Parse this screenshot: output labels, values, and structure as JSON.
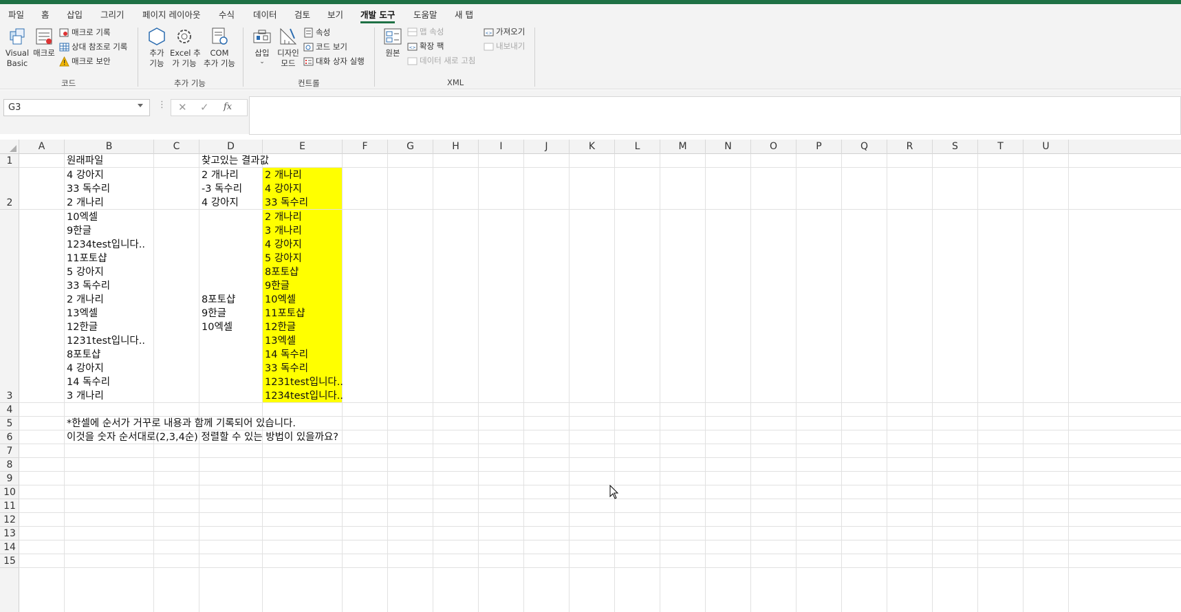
{
  "ribbon_tabs": [
    "파일",
    "홈",
    "삽입",
    "그리기",
    "페이지 레이아웃",
    "수식",
    "데이터",
    "검토",
    "보기",
    "개발 도구",
    "도움말",
    "새 탭"
  ],
  "active_tab": "개발 도구",
  "ribbon": {
    "code": {
      "label": "코드",
      "visual_basic": "Visual\nBasic",
      "macro": "매크로",
      "record_macro": "매크로 기록",
      "relative_ref": "상대 참조로 기록",
      "macro_security": "매크로 보안"
    },
    "addins": {
      "label": "추가 기능",
      "addins": "추가\n기능",
      "excel_addins": "Excel 추\n가 기능",
      "com_addins": "COM\n추가 기능"
    },
    "controls": {
      "label": "컨트롤",
      "insert": "삽입",
      "design_mode": "디자인\n모드",
      "properties": "속성",
      "view_code": "코드 보기",
      "run_dialog": "대화 상자 실행"
    },
    "xml": {
      "label": "XML",
      "source": "원본",
      "map_properties": "맵 속성",
      "expansion_packs": "확장 팩",
      "refresh_data": "데이터 새로 고침",
      "import": "가져오기",
      "export": "내보내기"
    }
  },
  "formula_bar": {
    "name_box": "G3",
    "cancel_glyph": "✕",
    "enter_glyph": "✓",
    "fx_glyph": "fx",
    "formula": ""
  },
  "columns": [
    "A",
    "B",
    "C",
    "D",
    "E",
    "F",
    "G",
    "H",
    "I",
    "J",
    "K",
    "L",
    "M",
    "N",
    "O",
    "P",
    "Q",
    "R",
    "S",
    "T",
    "U"
  ],
  "rows": [
    "1",
    "2",
    "3",
    "4",
    "5",
    "6",
    "7",
    "8",
    "9",
    "10",
    "11",
    "12",
    "13",
    "14",
    "15"
  ],
  "cells": {
    "B1": "원래파일",
    "D1": "찾고있는 결과값",
    "B2": [
      "4 강아지",
      "33 독수리",
      "2 개나리"
    ],
    "D2": [
      "2 개나리",
      "-3 독수리",
      "4 강아지"
    ],
    "E2": [
      "2 개나리",
      "4 강아지",
      "33 독수리"
    ],
    "B3": [
      "10엑셀",
      "9한글",
      "1234test입니다..",
      "11포토샵",
      "5 강아지",
      "33 독수리",
      "2 개나리",
      "13엑셀",
      "12한글",
      "1231test입니다..",
      "8포토샵",
      "4 강아지",
      "14 독수리",
      "3 개나리"
    ],
    "D3": [
      "8포토샵",
      "9한글",
      "10엑셀"
    ],
    "E3": [
      "2 개나리",
      "3 개나리",
      "4 강아지",
      "5 강아지",
      "8포토샵",
      "9한글",
      "10엑셀",
      "11포토샵",
      "12한글",
      "13엑셀",
      "14 독수리",
      "33 독수리",
      "1231test입니다..",
      "1234test입니다.."
    ],
    "B5": "*한셀에 순서가 거꾸로 내용과 함께 기록되어 있습니다.",
    "B6": "이것을 숫자 순서대로(2,3,4순) 정렬할 수 있는 방법이 있을까요?"
  },
  "highlight_color": "#ffff00",
  "accent_color": "#1e7145"
}
